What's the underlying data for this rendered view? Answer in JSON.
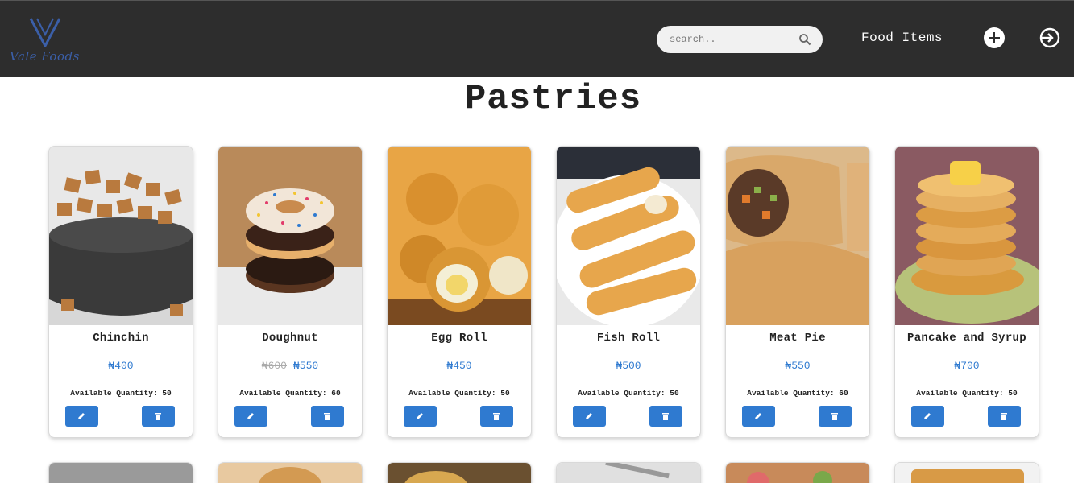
{
  "app": {
    "brand_text": "Vale Foods"
  },
  "search": {
    "placeholder": "search.."
  },
  "nav": {
    "food_items_label": "Food Items"
  },
  "page": {
    "title": "Pastries"
  },
  "currency_symbol": "₦",
  "items": [
    {
      "name": "Chinchin",
      "price": "₦400",
      "old_price": "",
      "quantity_label": "Available Quantity: 50"
    },
    {
      "name": "Doughnut",
      "price": "₦550",
      "old_price": "₦600",
      "quantity_label": "Available Quantity: 60"
    },
    {
      "name": "Egg Roll",
      "price": "₦450",
      "old_price": "",
      "quantity_label": "Available Quantity: 50"
    },
    {
      "name": "Fish Roll",
      "price": "₦500",
      "old_price": "",
      "quantity_label": "Available Quantity: 50"
    },
    {
      "name": "Meat Pie",
      "price": "₦550",
      "old_price": "",
      "quantity_label": "Available Quantity: 60"
    },
    {
      "name": "Pancake and Syrup",
      "price": "₦700",
      "old_price": "",
      "quantity_label": "Available Quantity: 50"
    }
  ],
  "colors": {
    "navbar": "#2d2d2d",
    "accent": "#2f7ad0",
    "logo": "#3b5fa8"
  },
  "icons": [
    "search-icon",
    "add-icon",
    "login-icon",
    "edit-icon",
    "delete-icon"
  ]
}
